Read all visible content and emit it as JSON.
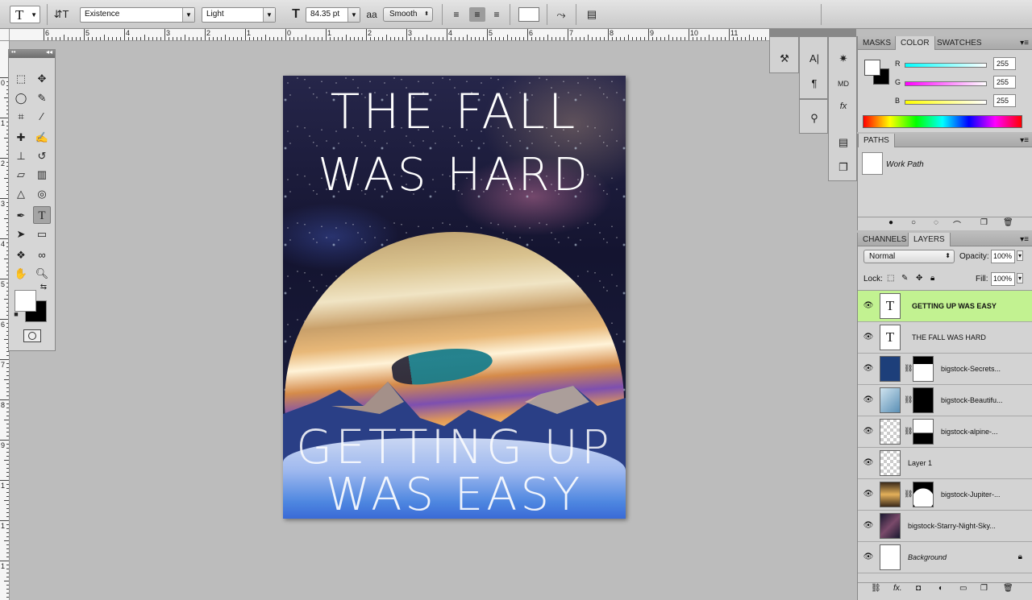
{
  "options_bar": {
    "tool_preset_icon": "type-tool-icon",
    "font_family": "Existence",
    "font_style": "Light",
    "font_size": "84.35 pt",
    "antialias_label": "aa",
    "antialias": "Smooth"
  },
  "ruler": {
    "h_labels": [
      "6",
      "5",
      "4",
      "3",
      "2",
      "1",
      "0",
      "1",
      "2",
      "3",
      "4",
      "5",
      "6",
      "7",
      "8",
      "9",
      "10",
      "11"
    ],
    "v_labels": [
      "0",
      "1",
      "2",
      "3",
      "4",
      "5",
      "6",
      "7",
      "8",
      "9",
      "1",
      "1",
      "1"
    ]
  },
  "canvas": {
    "line1": "THE FALL",
    "line2": "WAS HARD",
    "line3": "GETTING UP",
    "line4": "WAS EASY"
  },
  "color_panel": {
    "tabs": [
      "MASKS",
      "COLOR",
      "SWATCHES"
    ],
    "active_tab": "COLOR",
    "r_label": "R",
    "g_label": "G",
    "b_label": "B",
    "r": "255",
    "g": "255",
    "b": "255"
  },
  "paths_panel": {
    "tab": "PATHS",
    "item": "Work Path"
  },
  "layers_panel": {
    "tabs": [
      "CHANNELS",
      "LAYERS"
    ],
    "active_tab": "LAYERS",
    "blend_mode": "Normal",
    "opacity_label": "Opacity:",
    "opacity": "100%",
    "lock_label": "Lock:",
    "fill_label": "Fill:",
    "fill": "100%",
    "layers": [
      {
        "name": "GETTING UP WAS EASY",
        "type": "text",
        "selected": true
      },
      {
        "name": "THE FALL WAS HARD",
        "type": "text"
      },
      {
        "name": "bigstock-Secrets...",
        "type": "image-mask"
      },
      {
        "name": "bigstock-Beautifu...",
        "type": "image-mask"
      },
      {
        "name": "bigstock-alpine-...",
        "type": "image-mask"
      },
      {
        "name": "Layer 1",
        "type": "empty"
      },
      {
        "name": "bigstock-Jupiter-...",
        "type": "image-mask"
      },
      {
        "name": "bigstock-Starry-Night-Sky...",
        "type": "image"
      },
      {
        "name": "Background",
        "type": "background"
      }
    ]
  },
  "colors": {
    "selected_layer": "#c2f291",
    "panel_bg": "#d3d3d3",
    "workspace": "#bcbcbc"
  }
}
